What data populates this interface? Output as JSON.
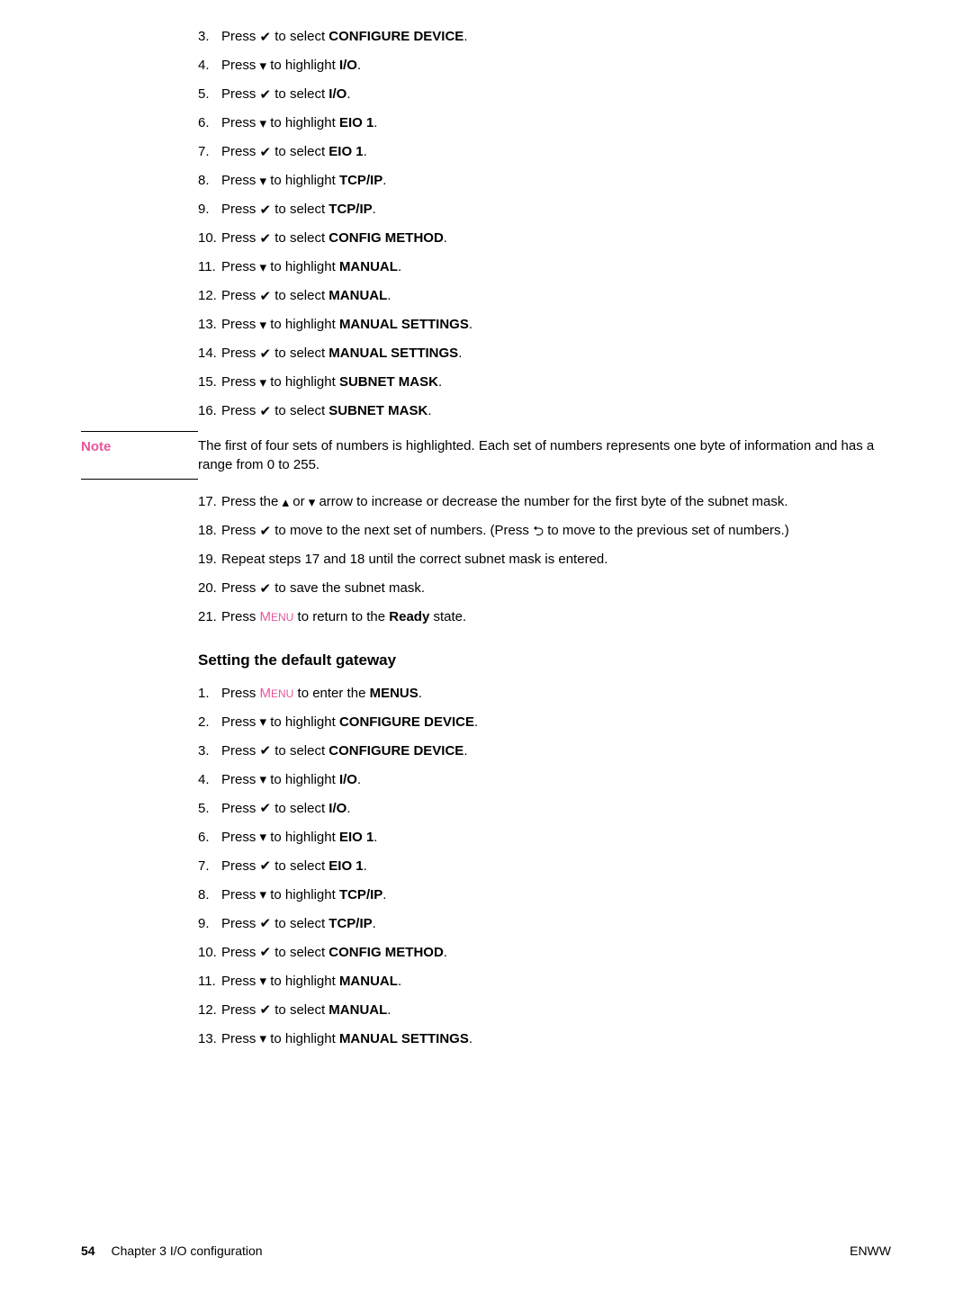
{
  "icons": {
    "check": "✔",
    "down": "▾",
    "up": "▴",
    "back": "⮌"
  },
  "menu_key": {
    "first": "M",
    "rest": "ENU"
  },
  "list1": [
    {
      "n": "3.",
      "pre": "Press ",
      "icon": "check",
      "mid": " to select ",
      "bold": "CONFIGURE DEVICE",
      "post": "."
    },
    {
      "n": "4.",
      "pre": "Press ",
      "icon": "down",
      "mid": " to highlight ",
      "bold": "I/O",
      "post": "."
    },
    {
      "n": "5.",
      "pre": "Press ",
      "icon": "check",
      "mid": " to select ",
      "bold": "I/O",
      "post": "."
    },
    {
      "n": "6.",
      "pre": "Press ",
      "icon": "down",
      "mid": " to highlight ",
      "bold": "EIO 1",
      "post": "."
    },
    {
      "n": "7.",
      "pre": "Press ",
      "icon": "check",
      "mid": " to select ",
      "bold": "EIO 1",
      "post": "."
    },
    {
      "n": "8.",
      "pre": "Press ",
      "icon": "down",
      "mid": " to highlight ",
      "bold": "TCP/IP",
      "post": "."
    },
    {
      "n": "9.",
      "pre": "Press ",
      "icon": "check",
      "mid": " to select ",
      "bold": "TCP/IP",
      "post": "."
    },
    {
      "n": "10.",
      "pre": "Press ",
      "icon": "check",
      "mid": " to select ",
      "bold": "CONFIG METHOD",
      "post": "."
    },
    {
      "n": "11.",
      "pre": "Press ",
      "icon": "down",
      "mid": " to highlight ",
      "bold": "MANUAL",
      "post": "."
    },
    {
      "n": "12.",
      "pre": "Press ",
      "icon": "check",
      "mid": " to select ",
      "bold": "MANUAL",
      "post": "."
    },
    {
      "n": "13.",
      "pre": "Press ",
      "icon": "down",
      "mid": " to highlight ",
      "bold": "MANUAL SETTINGS",
      "post": "."
    },
    {
      "n": "14.",
      "pre": "Press ",
      "icon": "check",
      "mid": " to select ",
      "bold": "MANUAL SETTINGS",
      "post": "."
    },
    {
      "n": "15.",
      "pre": "Press ",
      "icon": "down",
      "mid": " to highlight ",
      "bold": "SUBNET MASK",
      "post": "."
    },
    {
      "n": "16.",
      "pre": "Press ",
      "icon": "check",
      "mid": " to select ",
      "bold": "SUBNET MASK",
      "post": "."
    }
  ],
  "note": {
    "label": "Note",
    "body": "The first of four sets of numbers is highlighted. Each set of numbers represents one byte of information and has a range from 0 to 255."
  },
  "list2": {
    "17": {
      "n": "17.",
      "pre": "Press the ",
      "mid": " or ",
      "post": " arrow to increase or decrease the number for the first byte of the subnet mask."
    },
    "18": {
      "n": "18.",
      "pre": "Press ",
      "mid": " to move to the next set of numbers. (Press ",
      "post": " to move to the previous set of numbers.)"
    },
    "19": {
      "n": "19.",
      "txt": "Repeat steps 17 and 18 until the correct subnet mask is entered."
    },
    "20": {
      "n": "20.",
      "pre": "Press ",
      "post": " to save the subnet mask."
    },
    "21": {
      "n": "21.",
      "pre": "Press ",
      "mid": " to return to the ",
      "bold": "Ready",
      "post": " state."
    }
  },
  "heading2": "Setting the default gateway",
  "list3": [
    {
      "n": "1.",
      "special": "menu",
      "pre": "Press ",
      "mid": " to enter the ",
      "bold": "MENUS",
      "post": "."
    },
    {
      "n": "2.",
      "pre": "Press ",
      "icon": "down",
      "mid": " to highlight ",
      "bold": "CONFIGURE DEVICE",
      "post": "."
    },
    {
      "n": "3.",
      "pre": "Press ",
      "icon": "check",
      "mid": " to select ",
      "bold": "CONFIGURE DEVICE",
      "post": "."
    },
    {
      "n": "4.",
      "pre": "Press ",
      "icon": "down",
      "mid": " to highlight ",
      "bold": "I/O",
      "post": "."
    },
    {
      "n": "5.",
      "pre": "Press ",
      "icon": "check",
      "mid": " to select ",
      "bold": "I/O",
      "post": "."
    },
    {
      "n": "6.",
      "pre": "Press ",
      "icon": "down",
      "mid": " to highlight ",
      "bold": "EIO 1",
      "post": "."
    },
    {
      "n": "7.",
      "pre": "Press ",
      "icon": "check",
      "mid": " to select ",
      "bold": "EIO 1",
      "post": "."
    },
    {
      "n": "8.",
      "pre": "Press ",
      "icon": "down",
      "mid": " to highlight ",
      "bold": "TCP/IP",
      "post": "."
    },
    {
      "n": "9.",
      "pre": "Press ",
      "icon": "check",
      "mid": " to select ",
      "bold": "TCP/IP",
      "post": "."
    },
    {
      "n": "10.",
      "pre": "Press ",
      "icon": "check",
      "mid": " to select ",
      "bold": "CONFIG METHOD",
      "post": "."
    },
    {
      "n": "11.",
      "pre": "Press ",
      "icon": "down",
      "mid": " to highlight ",
      "bold": "MANUAL",
      "post": "."
    },
    {
      "n": "12.",
      "pre": "Press ",
      "icon": "check",
      "mid": " to select ",
      "bold": "MANUAL",
      "post": "."
    },
    {
      "n": "13.",
      "pre": "Press ",
      "icon": "down",
      "mid": " to highlight ",
      "bold": "MANUAL SETTINGS",
      "post": "."
    }
  ],
  "footer": {
    "page": "54",
    "chapter": "Chapter 3   I/O configuration",
    "right": "ENWW"
  }
}
